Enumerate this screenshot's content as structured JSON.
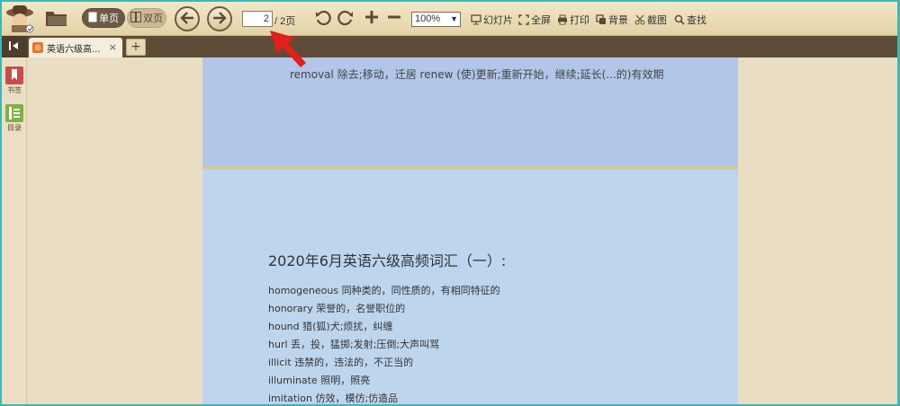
{
  "toolbar": {
    "single_page_label": "单页",
    "double_page_label": "双页",
    "current_page": "2",
    "total_pages": "/ 2页",
    "zoom_value": "100%",
    "slideshow_label": "幻灯片",
    "fullscreen_label": "全屏",
    "print_label": "打印",
    "background_label": "背景",
    "screenshot_label": "截图",
    "find_label": "查找"
  },
  "tabs": {
    "active_title": "英语六级高...",
    "close_glyph": "×",
    "new_tab_glyph": "+"
  },
  "sidebar": {
    "bookmarks_label": "书签",
    "toc_label": "目录"
  },
  "document": {
    "page1_line": "removal 除去;移动，迁居  renew (使)更新;重新开始，继续;延长(...的)有效期",
    "page2_heading": "2020年6月英语六级高频词汇（一）:",
    "vocab": [
      {
        "text": "homogeneous 同种类的，同性质的，有相同特征的"
      },
      {
        "text": "honorary 荣誉的，名誉职位的"
      },
      {
        "text": "hound 猎(狐)犬;烦扰，纠缠"
      },
      {
        "text": "hurl 丢，投，猛掷;发射;压倒;大声叫骂"
      },
      {
        "text": "illicit 违禁的，违法的，不正当的"
      },
      {
        "text": "illuminate 照明，照亮"
      },
      {
        "text": "imitation 仿效，模仿;仿造品"
      }
    ]
  },
  "colors": {
    "toolbar_bg": "#e9dab3",
    "tabbar_bg": "#5e4c37",
    "page1_bg": "#b1c6e8",
    "page2_bg": "#bed5ee",
    "annotation_arrow": "#e0201c"
  },
  "icons": [
    "app-logo-icon",
    "folder-open-icon",
    "single-page-icon",
    "double-page-icon",
    "arrow-left-icon",
    "arrow-right-icon",
    "rotate-left-icon",
    "rotate-right-icon",
    "zoom-in-icon",
    "zoom-out-icon",
    "slideshow-icon",
    "fullscreen-icon",
    "print-icon",
    "background-icon",
    "scissors-icon",
    "search-icon",
    "collapse-sidebar-icon",
    "bookmark-icon",
    "toc-icon",
    "red-arrow-icon"
  ]
}
